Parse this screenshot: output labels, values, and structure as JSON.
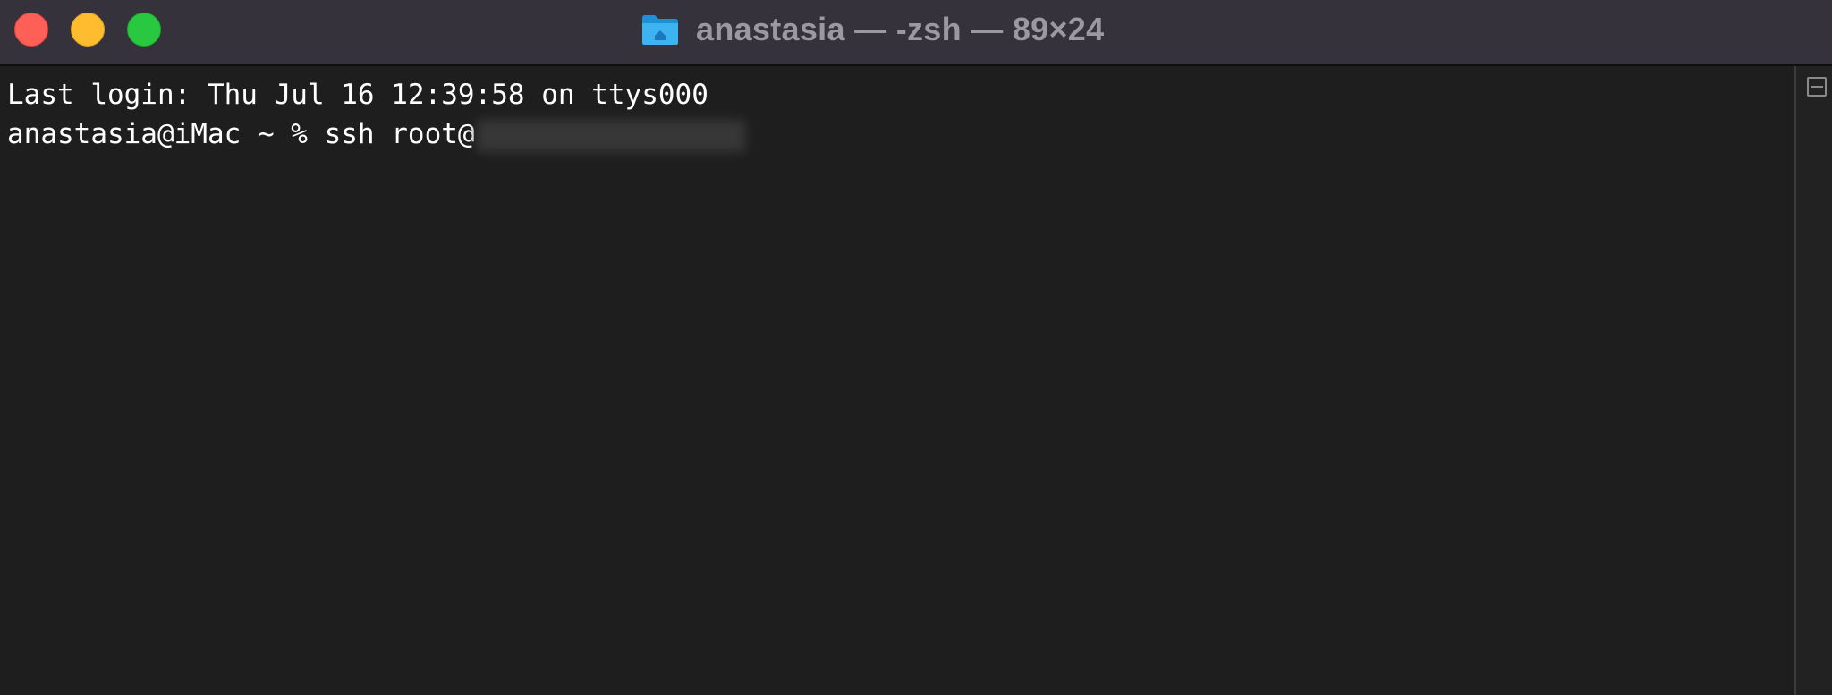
{
  "window": {
    "title": "anastasia — -zsh — 89×24",
    "title_icon": "folder-home-icon",
    "controls": {
      "close_color": "#fe5f57",
      "minimize_color": "#febc2e",
      "zoom_color": "#28c840"
    }
  },
  "terminal": {
    "lines": [
      "Last login: Thu Jul 16 12:39:58 on ttys000",
      "anastasia@iMac ~ % ssh root@"
    ],
    "redacted_host": "host-address-redacted",
    "background": "#1e1e1e",
    "text_color": "#ffffff"
  },
  "scrollbar": {
    "icon": "split-pane-icon"
  }
}
